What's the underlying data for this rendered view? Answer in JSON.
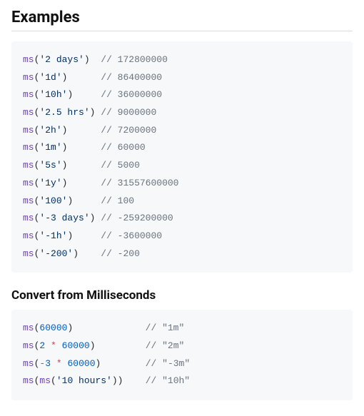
{
  "heading": "Examples",
  "examples": [
    {
      "input": "'2 days'",
      "pad": "  ",
      "result": "172800000"
    },
    {
      "input": "'1d'",
      "pad": "      ",
      "result": "86400000"
    },
    {
      "input": "'10h'",
      "pad": "     ",
      "result": "36000000"
    },
    {
      "input": "'2.5 hrs'",
      "pad": " ",
      "result": "9000000"
    },
    {
      "input": "'2h'",
      "pad": "      ",
      "result": "7200000"
    },
    {
      "input": "'1m'",
      "pad": "      ",
      "result": "60000"
    },
    {
      "input": "'5s'",
      "pad": "      ",
      "result": "5000"
    },
    {
      "input": "'1y'",
      "pad": "      ",
      "result": "31557600000"
    },
    {
      "input": "'100'",
      "pad": "     ",
      "result": "100"
    },
    {
      "input": "'-3 days'",
      "pad": " ",
      "result": "-259200000"
    },
    {
      "input": "'-1h'",
      "pad": "     ",
      "result": "-3600000"
    },
    {
      "input": "'-200'",
      "pad": "    ",
      "result": "-200"
    }
  ],
  "section2_heading": "Convert from Milliseconds",
  "convert": [
    {
      "call": [
        {
          "t": "num",
          "v": "60000"
        }
      ],
      "tail_pad": "             ",
      "result": "\"1m\""
    },
    {
      "call": [
        {
          "t": "num",
          "v": "2"
        },
        {
          "t": "plain",
          "v": " "
        },
        {
          "t": "op",
          "v": "*"
        },
        {
          "t": "plain",
          "v": " "
        },
        {
          "t": "num",
          "v": "60000"
        }
      ],
      "tail_pad": "         ",
      "result": "\"2m\""
    },
    {
      "call": [
        {
          "t": "op",
          "v": "-"
        },
        {
          "t": "num",
          "v": "3"
        },
        {
          "t": "plain",
          "v": " "
        },
        {
          "t": "op",
          "v": "*"
        },
        {
          "t": "plain",
          "v": " "
        },
        {
          "t": "num",
          "v": "60000"
        }
      ],
      "tail_pad": "        ",
      "result": "\"-3m\""
    },
    {
      "call": [
        {
          "t": "fn",
          "v": "ms"
        },
        {
          "t": "plain",
          "v": "("
        },
        {
          "t": "str",
          "v": "'10 hours'"
        },
        {
          "t": "plain",
          "v": ")"
        }
      ],
      "tail_pad": "    ",
      "result": "\"10h\""
    }
  ]
}
